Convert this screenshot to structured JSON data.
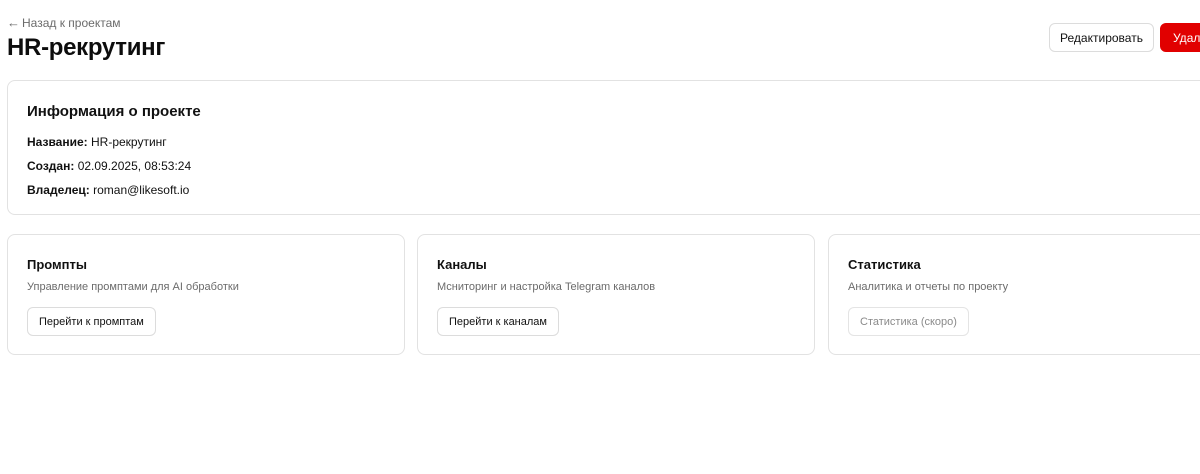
{
  "header": {
    "back_icon": "arrow-left-icon",
    "back_label": "Назад к проектам",
    "title": "HR-рекрутинг",
    "edit_label": "Редактировать",
    "delete_label": "Удали"
  },
  "info": {
    "title": "Информация о проекте",
    "name_label": "Название:",
    "name_value": "HR-рекрутинг",
    "created_label": "Создан:",
    "created_value": "02.09.2025, 08:53:24",
    "owner_label": "Владелец:",
    "owner_value": "roman@likesoft.io"
  },
  "cards": [
    {
      "title": "Промпты",
      "description": "Управление промптами для AI обработки",
      "button": "Перейти к промптам",
      "disabled": false
    },
    {
      "title": "Каналы",
      "description": "Мсниторинг и настройка Telegram каналов",
      "button": "Перейти к каналам",
      "disabled": false
    },
    {
      "title": "Статистика",
      "description": "Аналитика и отчеты по проекту",
      "button": "Статистика (скоро)",
      "disabled": true
    }
  ],
  "colors": {
    "danger": "#e10000",
    "muted_text": "#6b6b6b",
    "border": "#e2e2e2"
  }
}
